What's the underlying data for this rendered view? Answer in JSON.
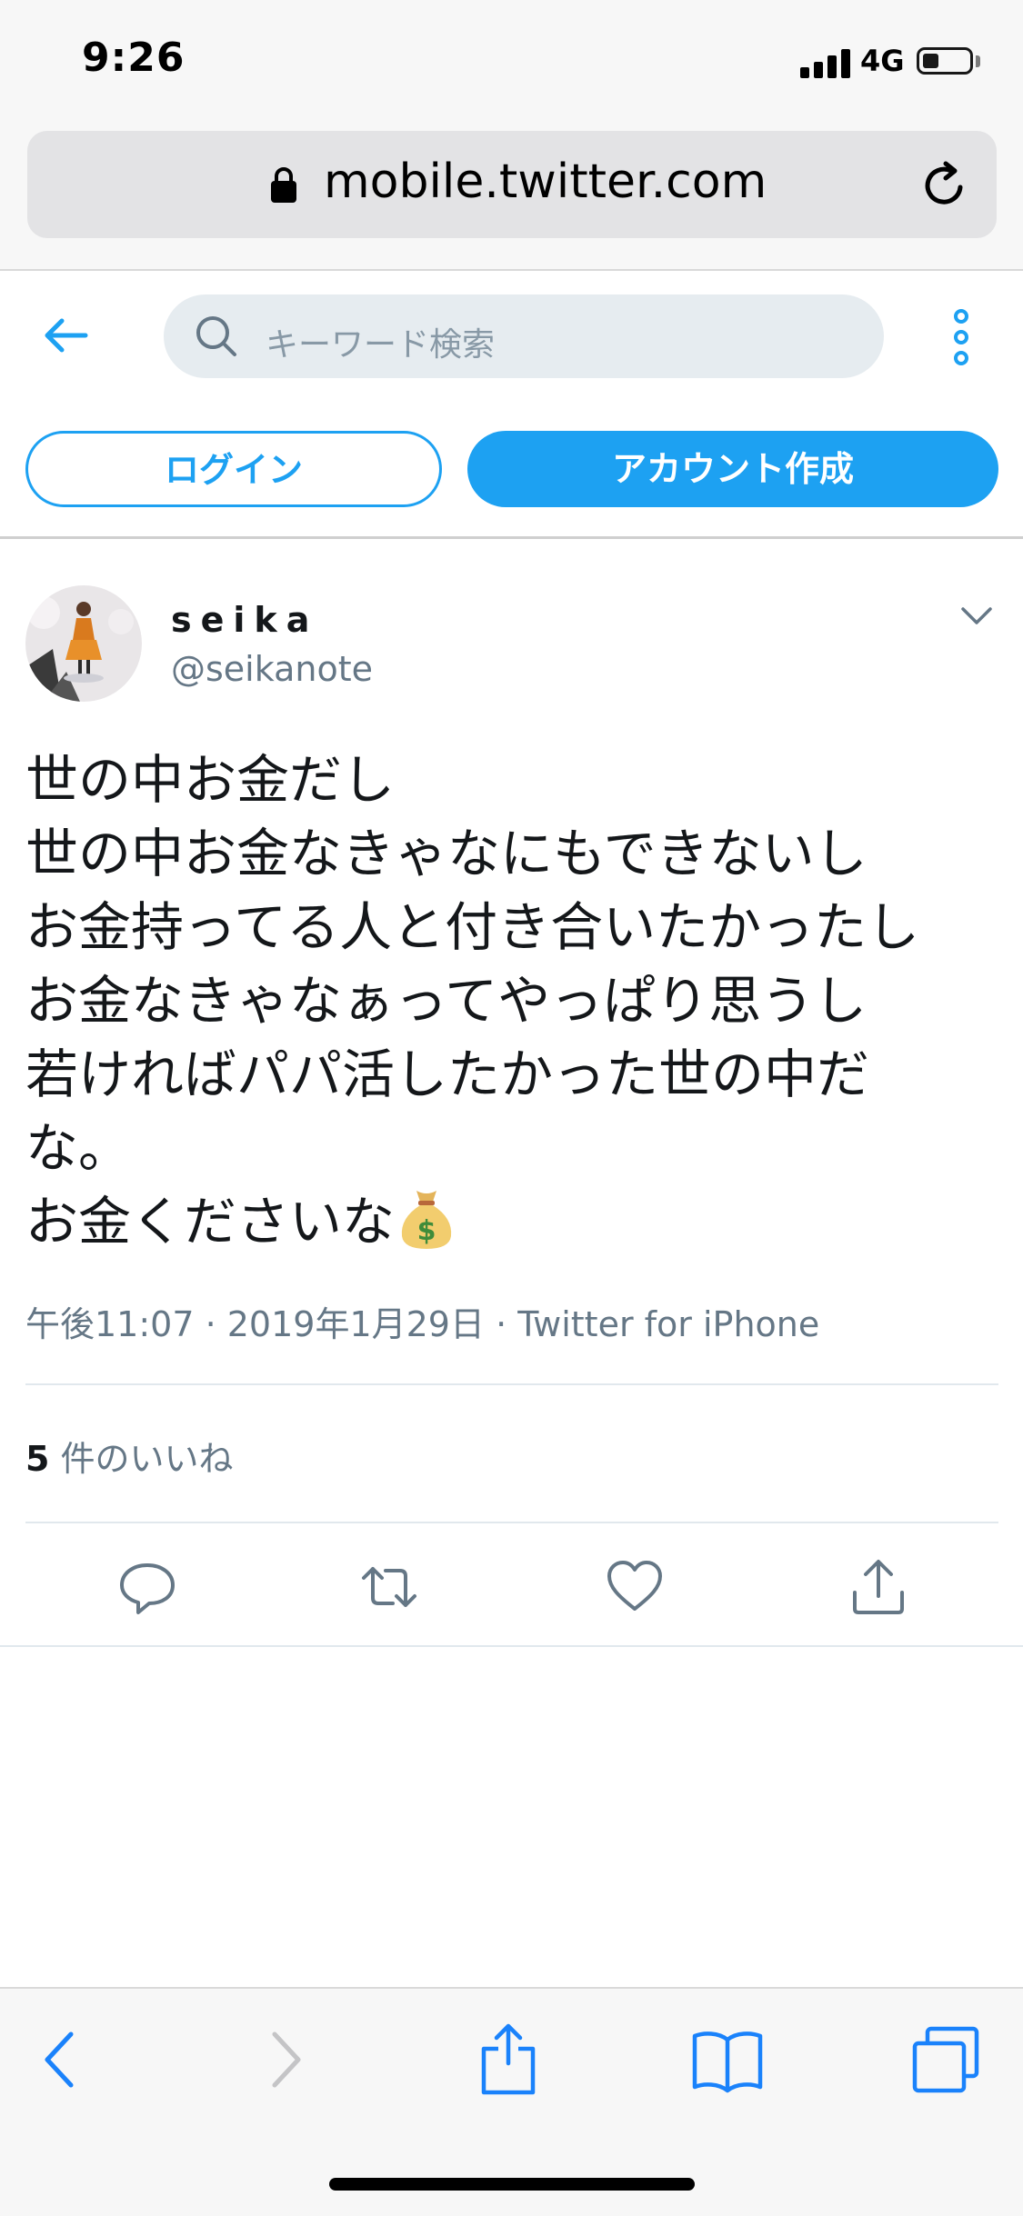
{
  "status_bar": {
    "time": "9:26",
    "network": "4G",
    "battery_level": 0.35
  },
  "browser": {
    "url": "mobile.twitter.com"
  },
  "header": {
    "search_placeholder": "キーワード検索",
    "login_label": "ログイン",
    "signup_label": "アカウント作成"
  },
  "tweet": {
    "display_name": "seika",
    "handle": "@seikanote",
    "lines": [
      "世の中お金だし",
      "世の中お金なきゃなにもできないし",
      "お金持ってる人と付き合いたかったし",
      "お金なきゃなぁってやっぱり思うし",
      "若ければパパ活したかった世の中だ",
      "な。",
      "お金くださいな"
    ],
    "timestamp": "午後11:07 · 2019年1月29日 · Twitter for iPhone",
    "likes_count": "5",
    "likes_label": "件のいいね"
  },
  "colors": {
    "accent": "#1da1f2",
    "secondary_text": "#657786"
  }
}
